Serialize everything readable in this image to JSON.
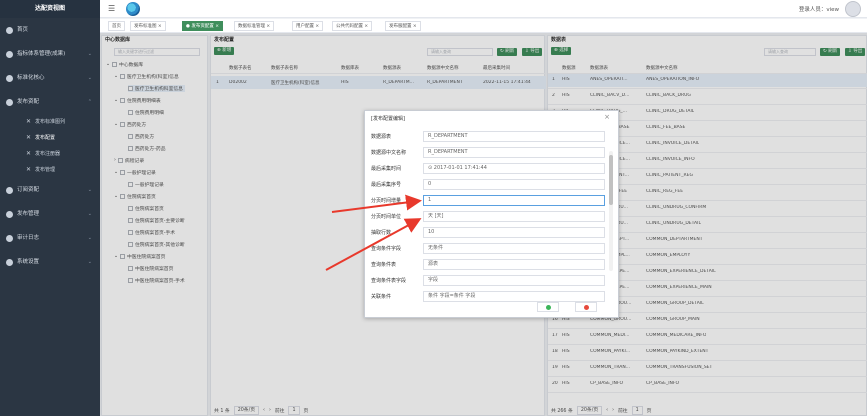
{
  "app": {
    "title": "达配资视图",
    "user_label": "登录人员：view"
  },
  "sidebar": {
    "items": [
      {
        "label": "首页"
      },
      {
        "label": "指标体系管理(成果)"
      },
      {
        "label": "标准化核心"
      },
      {
        "label": "发布资配"
      },
      {
        "label": "订阅资配"
      },
      {
        "label": "发布管理"
      },
      {
        "label": "审计日志"
      },
      {
        "label": "系统设置"
      }
    ],
    "subitems": [
      {
        "label": "发布标准图列"
      },
      {
        "label": "发布配置"
      },
      {
        "label": "发布注册器"
      },
      {
        "label": "发布管理"
      }
    ]
  },
  "tabs": [
    {
      "label": "首页"
    },
    {
      "label": "发布标准图 ×"
    },
    {
      "label": "● 发布资配置 ×"
    },
    {
      "label": "数据标准管理 ×"
    },
    {
      "label": "用户配置 ×"
    },
    {
      "label": "公共代码配置 ×"
    },
    {
      "label": "发布服配置 ×"
    }
  ],
  "left_panel": {
    "title": "中心数据库",
    "search_placeholder": "输入关键字进行过滤",
    "tree": [
      "中心数据库",
      "医疗卫生机构(科室)信息",
      "医疗卫生机构科室信息",
      "住院费用明细表",
      "住院费用明细",
      "西药处方",
      "西药处方",
      "西药处方-药品",
      "病程记录",
      "一般护理记录",
      "一般护理记录",
      "住院病案首页",
      "住院病案首页",
      "住院病案首页-主要诊断",
      "住院病案首页-手术",
      "住院病案首页-其他诊断",
      "中医住院病案首页",
      "中医住院病案首页",
      "中医住院病案首页-手术"
    ]
  },
  "mid_panel": {
    "title": "发布配置",
    "add_label": "新增",
    "search_placeholder": "请输入查询",
    "refresh_label": "刷新",
    "export_label": "导出",
    "columns": [
      "数据子表名",
      "数据子表名称",
      "数据库表",
      "数据源表",
      "数据源中文名称",
      "最后采集时间"
    ],
    "rows": [
      [
        "1",
        "D02002",
        "医疗卫生机构(科室)信息",
        "HIS",
        "R_DEPARTM...",
        "R_DEPARTMENT",
        "2022-11-15 17:41:44"
      ]
    ],
    "pagination": {
      "total": "共 1 条",
      "per_page": "20条/页",
      "goto": "前往",
      "page": "1",
      "unit": "页"
    }
  },
  "right_panel": {
    "title": "数据表",
    "add_label": "选择",
    "search_placeholder": "请输入查询",
    "refresh_label": "刷新",
    "export_label": "导出",
    "columns": [
      "数据源",
      "数据源表",
      "数据源中文名称"
    ],
    "rows": [
      [
        "1",
        "HIS",
        "ANES_OPERATI...",
        "ANES_OPERATION_INFO"
      ],
      [
        "2",
        "HIS",
        "CLINIC_BACV_D...",
        "CLINIC_BACK_DRUG"
      ],
      [
        "3",
        "HIS",
        "CLINIC_DRUG_...",
        "CLINIC_DRUG_DETAIL"
      ],
      [
        "4",
        "HIS",
        "CLINIC_FEE_BASE",
        "CLINIC_FEE_BASE"
      ],
      [
        "5",
        "HIS",
        "CLINIC_INVOICE...",
        "CLINIC_INVOICE_DETAIL"
      ],
      [
        "6",
        "HIS",
        "CLINIC_INVOICE...",
        "CLINIC_INVOICE_INFO"
      ],
      [
        "7",
        "HIS",
        "CLINIC_PATIENT...",
        "CLINIC_PATIENT_REG"
      ],
      [
        "8",
        "HIS",
        "CLINIC_REG_FEE",
        "CLINIC_REG_FEE"
      ],
      [
        "9",
        "HIS",
        "CLINIC_UNDRU...",
        "CLINIC_UNDRUG_CONFIRM"
      ],
      [
        "10",
        "HIS",
        "CLINIC_UNDRU...",
        "CLINIC_UNDRUG_DETAIL"
      ],
      [
        "11",
        "HIS",
        "COMMON_DEPT...",
        "COMMON_DEPTARTMENT"
      ],
      [
        "12",
        "HIS",
        "COMMON_EMPL...",
        "COMMON_EMPLOYY"
      ],
      [
        "13",
        "HIS",
        "COMMON_EXPE...",
        "COMMON_EXPERIENCE_DETAIL"
      ],
      [
        "14",
        "HIS",
        "COMMON_EXPE...",
        "COMMON_EXPERIENCE_MAIN"
      ],
      [
        "15",
        "HIS",
        "COMMON_GROU...",
        "COMMON_GROUP_DETAIL"
      ],
      [
        "16",
        "HIS",
        "COMMON_GROU...",
        "COMMON_GROUP_MAIN"
      ],
      [
        "17",
        "HIS",
        "COMMON_MEDI...",
        "COMMON_MEDICARE_INFO"
      ],
      [
        "18",
        "HIS",
        "COMMON_PAYKI...",
        "COMMON_PAYKIND_EXTENT"
      ],
      [
        "19",
        "HIS",
        "COMMON_TRAN...",
        "COMMON_TRANSFUSION_SET"
      ],
      [
        "20",
        "HIS",
        "CP_BASE_INFO",
        "CP_BASE_INFO"
      ]
    ],
    "pagination": {
      "total": "共 266 条",
      "per_page": "20条/页",
      "goto": "前往",
      "page": "1",
      "unit": "页"
    }
  },
  "modal": {
    "title": "[发布配置编辑]",
    "fields": [
      {
        "label": "数据源表",
        "value": "R_DEPARTMENT"
      },
      {
        "label": "数据源中文名称",
        "value": "R_DEPARTMENT"
      },
      {
        "label": "最后采集时间",
        "value": "⊙  2017-01-01 17:41:44"
      },
      {
        "label": "最后采集序号",
        "value": "0"
      },
      {
        "label": "分页时间增量",
        "value": "1"
      },
      {
        "label": "分页时间单位",
        "value": "天 [天]"
      },
      {
        "label": "抽取行数",
        "value": "10"
      },
      {
        "label": "查询条件字段",
        "value": "无条件"
      },
      {
        "label": "查询条件表",
        "value": "源表"
      },
      {
        "label": "查询条件表字段",
        "value": "字段"
      },
      {
        "label": "关联条件",
        "value": "条件 字段=条件 字段"
      }
    ]
  },
  "colors": {
    "accent_green": "#3f8e5c",
    "sidebar_bg": "#2b3643",
    "arrow_red": "#e8392c",
    "ok_green": "#3cb55a",
    "cancel_red": "#e64a3c"
  }
}
